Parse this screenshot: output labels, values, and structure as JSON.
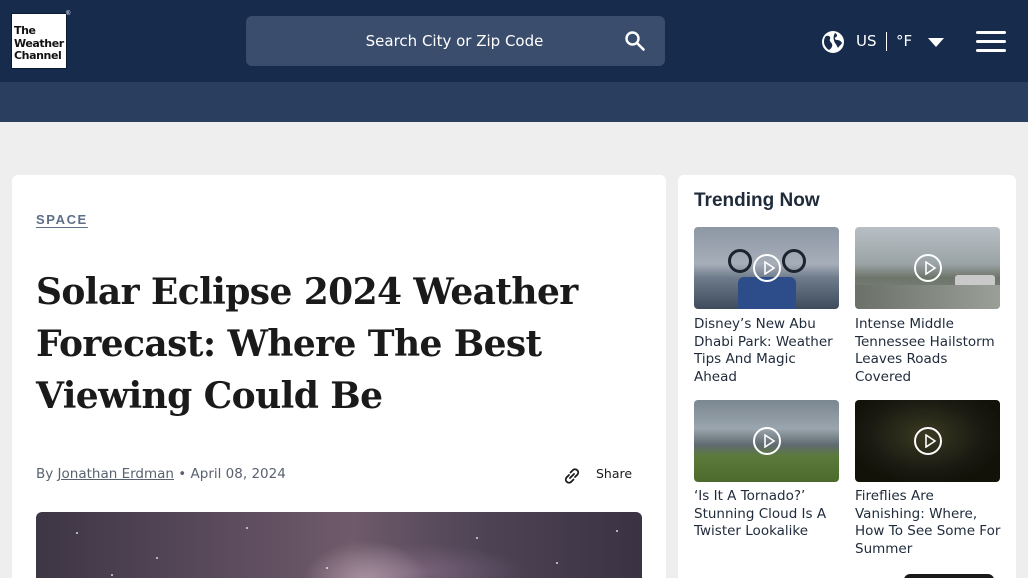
{
  "header": {
    "logo_lines": [
      "The",
      "Weather",
      "Channel"
    ],
    "search": {
      "placeholder": "Search City or Zip Code"
    },
    "locale": {
      "region": "US",
      "unit": "°F"
    },
    "colors": {
      "topbar": "#172b4d",
      "subbar": "#2a3e60"
    }
  },
  "article": {
    "kicker": "SPACE",
    "headline": "Solar Eclipse 2024 Weather Forecast: Where The Best Viewing Could Be",
    "byline": {
      "prefix": "By ",
      "author": "Jonathan Erdman",
      "separator": " • ",
      "date": "April 08, 2024"
    },
    "share_label": "Share"
  },
  "trending": {
    "title": "Trending Now",
    "items": [
      {
        "caption": "Disney’s New Abu Dhabi Park: Weather Tips And Magic Ahead",
        "icon": "play-icon"
      },
      {
        "caption": "Intense Middle Tennessee Hailstorm Leaves Roads Covered",
        "icon": "play-icon"
      },
      {
        "caption": "‘Is It A Tornado?’ Stunning Cloud Is A Twister Lookalike",
        "icon": "play-icon"
      },
      {
        "caption": "Fireflies Are Vanishing: Where, How To See Some For Summer",
        "icon": "play-icon"
      }
    ]
  }
}
